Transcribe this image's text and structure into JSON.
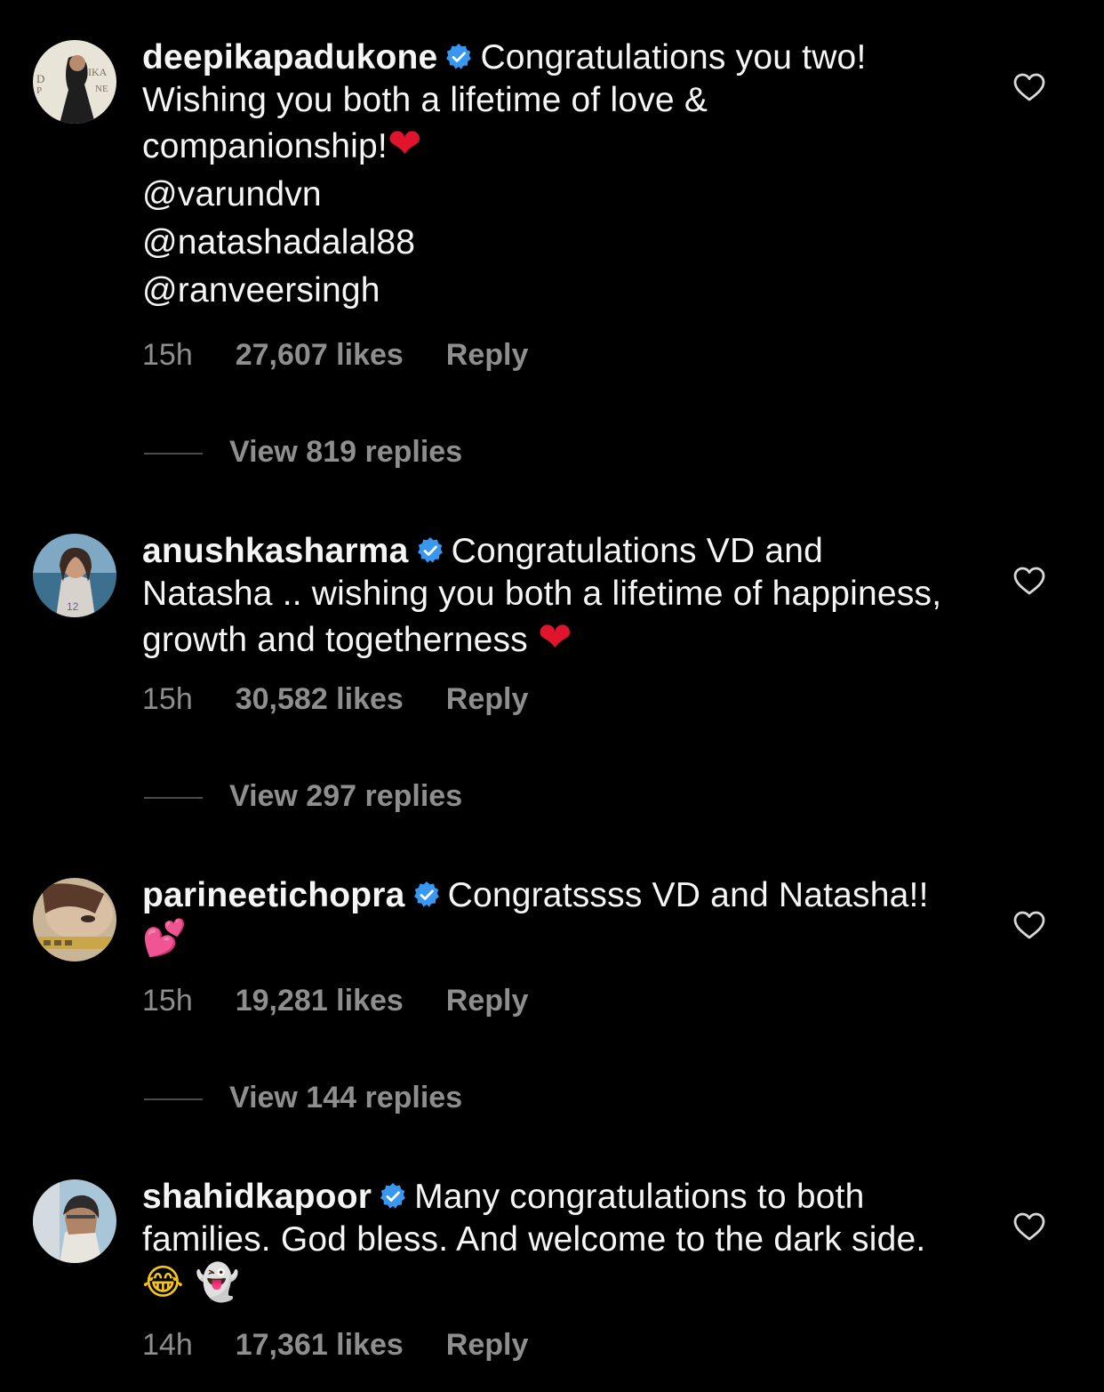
{
  "comments": [
    {
      "username": "deepikapadukone",
      "text": "Congratulations you two! Wishing you both a lifetime of love & companionship!",
      "emoji": "❤",
      "mentions": [
        "@varundvn",
        "@natashadalal88",
        "@ranveersingh"
      ],
      "time": "15h",
      "likes": "27,607 likes",
      "reply": "Reply",
      "view_replies": "View 819 replies"
    },
    {
      "username": "anushkasharma",
      "text": "Congratulations VD and Natasha .. wishing you both a lifetime of happiness, growth and togetherness",
      "emoji": "❤",
      "time": "15h",
      "likes": "30,582 likes",
      "reply": "Reply",
      "view_replies": "View 297 replies"
    },
    {
      "username": "parineetichopra",
      "text": "Congratssss VD and Natasha!!",
      "emoji": "💕",
      "time": "15h",
      "likes": "19,281 likes",
      "reply": "Reply",
      "view_replies": "View 144 replies"
    },
    {
      "username": "shahidkapoor",
      "text": "Many congratulations to both families. God bless. And welcome to the dark side.",
      "emoji": "😂 👻",
      "time": "14h",
      "likes": "17,361 likes",
      "reply": "Reply"
    }
  ],
  "colors": {
    "background": "#000000",
    "text": "#f5f5f5",
    "secondary": "#8e8e8e",
    "verified": "#3897f0",
    "heart_emoji": "#e0142c"
  },
  "icons": {
    "verified": "verified-badge-icon",
    "like": "heart-outline-icon"
  }
}
